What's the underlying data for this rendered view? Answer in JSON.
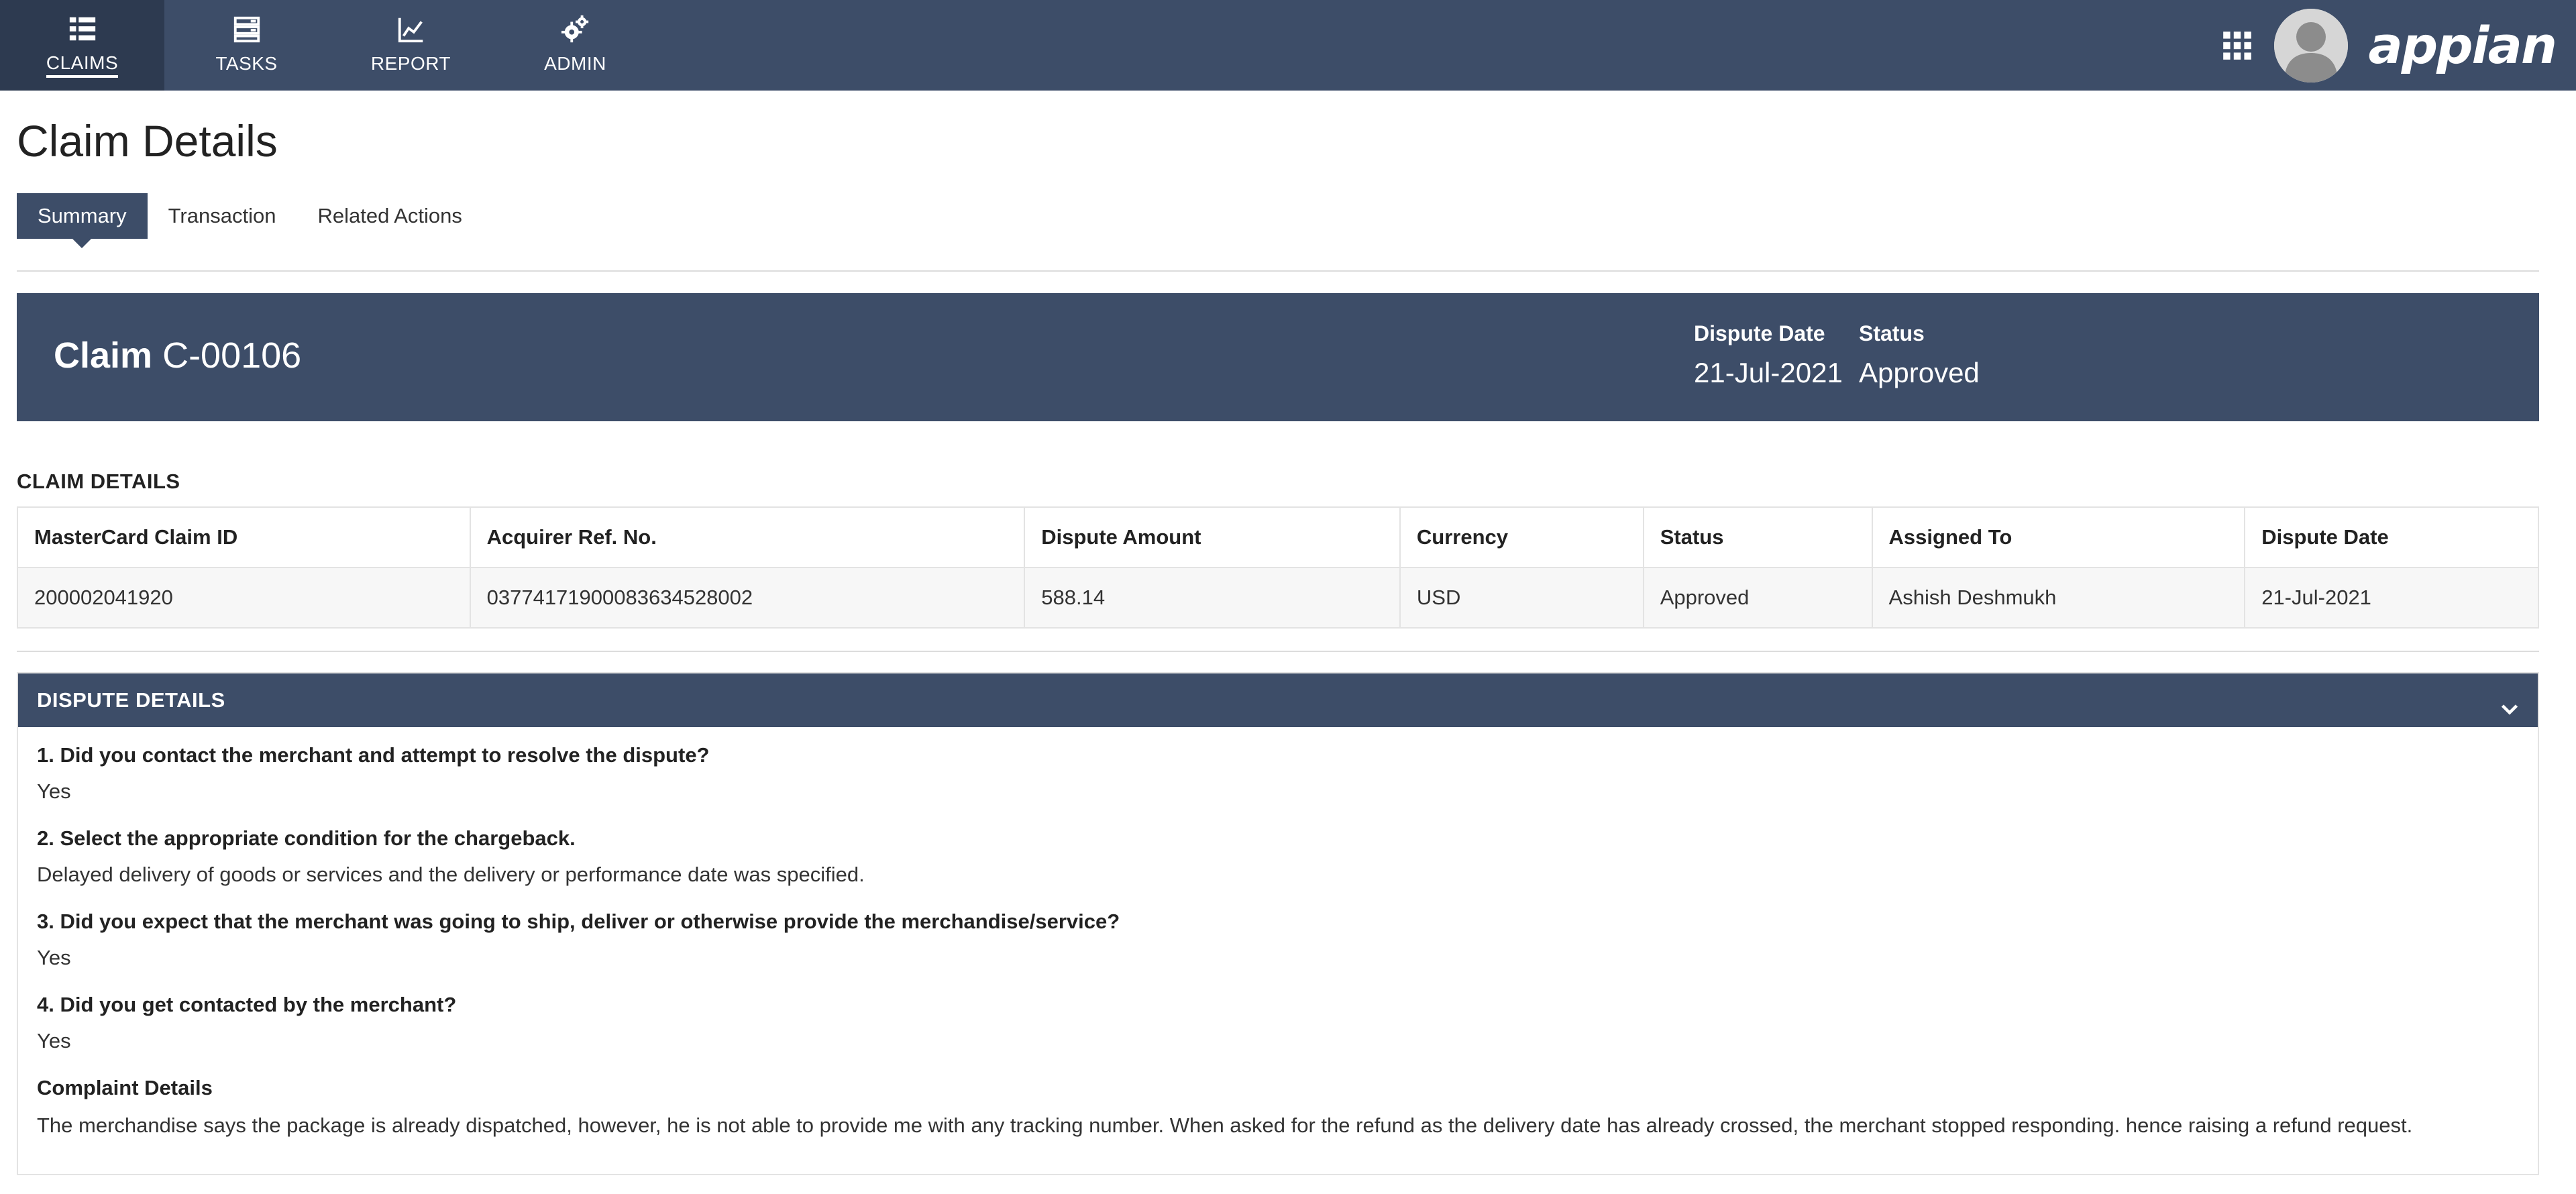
{
  "nav": {
    "items": [
      {
        "label": "CLAIMS",
        "icon": "list-icon",
        "active": true
      },
      {
        "label": "TASKS",
        "icon": "tasks-icon",
        "active": false
      },
      {
        "label": "REPORT",
        "icon": "report-chart-icon",
        "active": false
      },
      {
        "label": "ADMIN",
        "icon": "admin-gears-icon",
        "active": false
      }
    ],
    "brand": "appian",
    "apps_icon": "app-grid-icon",
    "avatar_icon": "user-avatar-icon"
  },
  "page": {
    "title": "Claim Details",
    "tabs": [
      {
        "label": "Summary",
        "active": true
      },
      {
        "label": "Transaction",
        "active": false
      },
      {
        "label": "Related Actions",
        "active": false
      }
    ]
  },
  "banner": {
    "claim_keyword": "Claim",
    "claim_id": "C-00106",
    "dispute_date_label": "Dispute Date",
    "dispute_date": "21-Jul-2021",
    "status_label": "Status",
    "status": "Approved"
  },
  "claim_details": {
    "section_label": "CLAIM DETAILS",
    "columns": [
      "MasterCard Claim ID",
      "Acquirer Ref. No.",
      "Dispute Amount",
      "Currency",
      "Status",
      "Assigned To",
      "Dispute Date"
    ],
    "rows": [
      [
        "200002041920",
        "03774171900083634528002",
        "588.14",
        "USD",
        "Approved",
        "Ashish Deshmukh",
        "21-Jul-2021"
      ]
    ]
  },
  "dispute_details": {
    "header": "DISPUTE DETAILS",
    "items": [
      {
        "question": "1. Did you contact the merchant and attempt to resolve the dispute?",
        "answer": "Yes"
      },
      {
        "question": "2. Select the appropriate condition for the chargeback.",
        "answer": "Delayed delivery of goods or services and the delivery or performance date was specified."
      },
      {
        "question": "3. Did you expect that the merchant was going to ship, deliver or otherwise provide the merchandise/service?",
        "answer": "Yes"
      },
      {
        "question": "4. Did you get contacted by the merchant?",
        "answer": "Yes"
      }
    ],
    "complaint_label": "Complaint Details",
    "complaint_text": "The merchandise says the package is already dispatched, however, he is not able to provide me with any tracking number. When asked for the refund as the delivery date has already crossed, the merchant stopped responding. hence raising a refund request."
  },
  "colors": {
    "nav_bg": "#3d4d68",
    "nav_active_bg": "#2d3a50",
    "banner_bg": "#3d4d68"
  }
}
